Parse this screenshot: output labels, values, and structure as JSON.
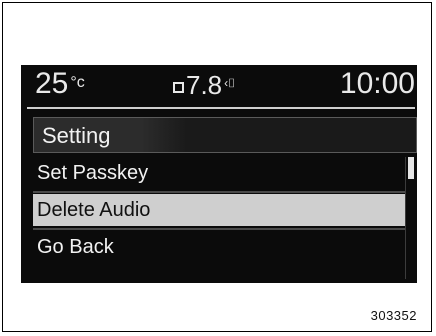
{
  "status": {
    "temperature": "25",
    "temperature_unit": "°c",
    "fuel_economy": "7.8",
    "fuel_icon": "fuel-economy-icon",
    "clock": "10:00"
  },
  "menu": {
    "title": "Setting",
    "items": [
      {
        "label": "Set Passkey",
        "selected": false
      },
      {
        "label": "Delete Audio",
        "selected": true
      },
      {
        "label": "Go Back",
        "selected": false
      }
    ],
    "scroll_position": 0.0
  },
  "figure_id": "303352",
  "colors": {
    "screen_bg": "#0b0b0b",
    "text": "#f2f2f2",
    "selected_bg": "#cfcfcf"
  }
}
